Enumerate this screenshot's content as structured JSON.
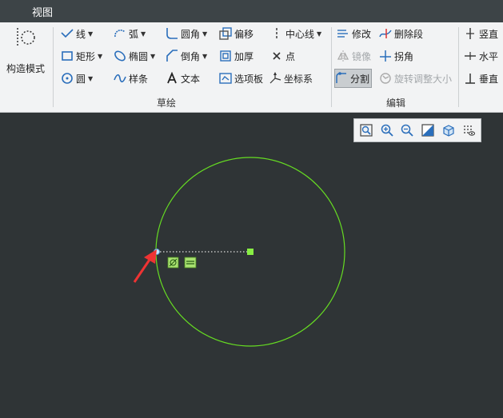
{
  "menubar": {
    "view": "视图"
  },
  "ribbon": {
    "construct_mode": "构造模式",
    "sketch": {
      "group_label": "草绘",
      "line": "线",
      "arc": "弧",
      "fillet": "圆角",
      "offset": "偏移",
      "centerline": "中心线",
      "rectangle": "矩形",
      "ellipse": "椭圆",
      "chamfer": "倒角",
      "thicken": "加厚",
      "point": "点",
      "circle": "圆",
      "spline": "样条",
      "text": "文本",
      "palette": "选项板",
      "coord_system": "坐标系"
    },
    "edit": {
      "group_label": "编辑",
      "modify": "修改",
      "delete_segment": "删除段",
      "mirror": "镜像",
      "corner": "拐角",
      "divide": "分割",
      "rotate_resize": "旋转调整大小"
    },
    "constrain": {
      "vertical": "竖直",
      "horizontal": "水平",
      "perpendicular": "垂直"
    }
  },
  "colors": {
    "canvas": "#2f3436",
    "sketch_geometry": "#66dd22",
    "arrow": "#ee3333"
  }
}
